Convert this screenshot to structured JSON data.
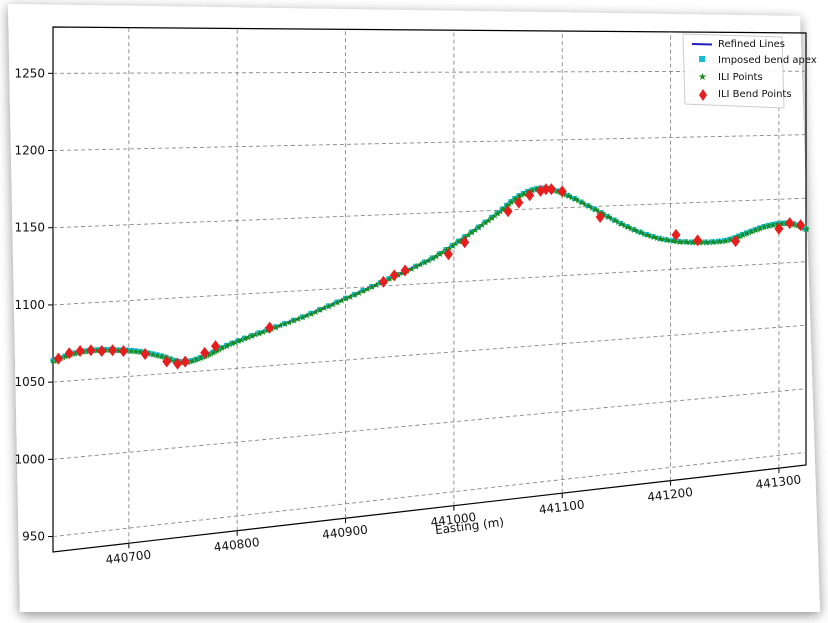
{
  "chart_data": {
    "type": "line",
    "title": "",
    "xlabel": "Easting (m)",
    "ylabel": "",
    "xlim": [
      440630,
      441325
    ],
    "ylim": [
      940,
      1280
    ],
    "xticks": [
      440700,
      440800,
      440900,
      441000,
      441100,
      441200,
      441300
    ],
    "xtick_labels": [
      "440700",
      "440800",
      "440900",
      "441000",
      "441100",
      "441200",
      "441300"
    ],
    "yticks": [
      950,
      1000,
      1050,
      1100,
      1150,
      1200,
      1250
    ],
    "ytick_labels": [
      "950",
      "1000",
      "1050",
      "1100",
      "1150",
      "1200",
      "1250"
    ],
    "grid": true,
    "legend_position": "top-right",
    "legend": [
      {
        "label": "Refined Lines",
        "marker": "line",
        "color": "#1f1fbf"
      },
      {
        "label": "Imposed bend apex",
        "marker": "square",
        "color": "#17becf"
      },
      {
        "label": "ILI Points",
        "marker": "star",
        "color": "#1a8a1a"
      },
      {
        "label": "ILI Bend Points",
        "marker": "diamond",
        "color": "#e61e1e"
      }
    ],
    "series": [
      {
        "name": "Refined Lines",
        "x": [
          440630,
          440650,
          440670,
          440690,
          440710,
          440730,
          440750,
          440770,
          440790,
          440820,
          440860,
          440900,
          440940,
          440980,
          441010,
          441040,
          441060,
          441080,
          441100,
          441130,
          441160,
          441190,
          441220,
          441250,
          441270,
          441290,
          441310,
          441325
        ],
        "y": [
          1064,
          1068,
          1069,
          1068,
          1066,
          1062,
          1057,
          1060,
          1066,
          1073,
          1082,
          1093,
          1105,
          1118,
          1132,
          1148,
          1160,
          1165,
          1161,
          1148,
          1134,
          1124,
          1120,
          1120,
          1125,
          1130,
          1131,
          1126
        ]
      },
      {
        "name": "ILI Bend Points",
        "x": [
          440635,
          440645,
          440655,
          440665,
          440675,
          440685,
          440695,
          440715,
          440735,
          440745,
          440752,
          440770,
          440780,
          440830,
          440935,
          440945,
          440955,
          440995,
          441010,
          441050,
          441060,
          441070,
          441080,
          441085,
          441090,
          441100,
          441135,
          441205,
          441225,
          441260,
          441300,
          441310,
          441320
        ],
        "y": [
          1065,
          1068,
          1069,
          1069,
          1068,
          1068,
          1067,
          1064,
          1058,
          1056,
          1057,
          1062,
          1066,
          1076,
          1103,
          1107,
          1110,
          1120,
          1128,
          1149,
          1155,
          1160,
          1163,
          1164,
          1164,
          1162,
          1142,
          1126,
          1121,
          1119,
          1127,
          1131,
          1129
        ]
      }
    ]
  }
}
